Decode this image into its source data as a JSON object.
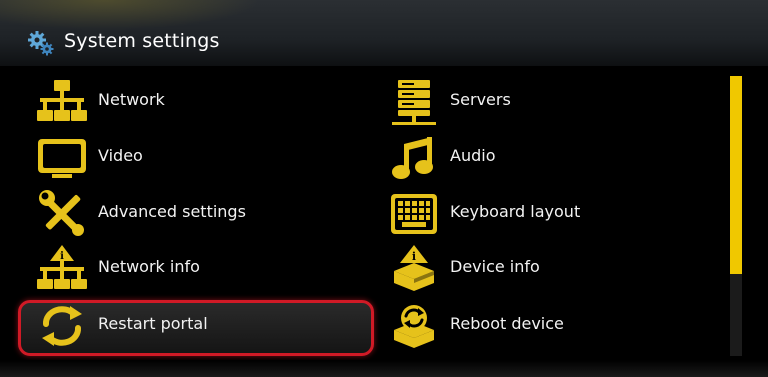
{
  "header": {
    "title": "System settings",
    "icon": "gears-icon"
  },
  "colors": {
    "accent": "#e6c21b",
    "selection_border": "#d01a26",
    "scrollbar": "#f0c800"
  },
  "menu": {
    "left": [
      {
        "label": "Network",
        "icon": "network-icon"
      },
      {
        "label": "Video",
        "icon": "tv-icon"
      },
      {
        "label": "Advanced settings",
        "icon": "tools-icon"
      },
      {
        "label": "Network info",
        "icon": "network-info-icon"
      },
      {
        "label": "Restart portal",
        "icon": "restart-icon",
        "selected": true
      }
    ],
    "right": [
      {
        "label": "Servers",
        "icon": "servers-icon"
      },
      {
        "label": "Audio",
        "icon": "music-note-icon"
      },
      {
        "label": "Keyboard layout",
        "icon": "keyboard-icon"
      },
      {
        "label": "Device info",
        "icon": "device-info-icon"
      },
      {
        "label": "Reboot device",
        "icon": "reboot-icon"
      }
    ]
  }
}
